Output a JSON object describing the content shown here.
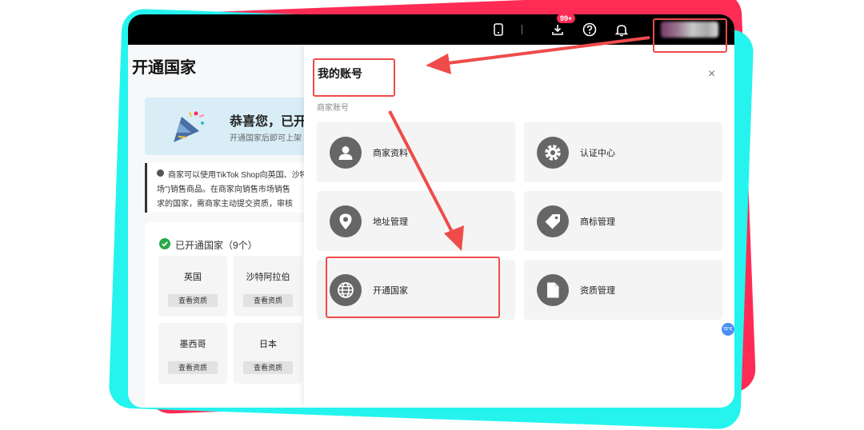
{
  "topbar": {
    "download_badge": "99+",
    "icons": [
      "phone-icon",
      "download-icon",
      "help-icon",
      "bell-icon"
    ]
  },
  "page": {
    "title": "开通国家",
    "banner": {
      "title": "恭喜您，已开通",
      "subtitle": "开通国家后即可上架"
    },
    "notice": {
      "lines": [
        "商家可以使用TikTok Shop向英国、沙特",
        "场\")销售商品。在商家向销售市场销售",
        "求的国家，需商家主动提交资质，审核"
      ]
    },
    "opened": {
      "title": "已开通国家（9个）",
      "countries": [
        {
          "name": "英国",
          "button": "查看资质"
        },
        {
          "name": "沙特阿拉伯",
          "button": "查看资质"
        },
        {
          "name": "墨西哥",
          "button": "查看资质"
        },
        {
          "name": "日本",
          "button": "查看资质"
        }
      ]
    }
  },
  "modal": {
    "title": "我的账号",
    "close": "×",
    "section": "商家账号",
    "tiles": [
      {
        "label": "商家资料",
        "icon": "user-icon"
      },
      {
        "label": "认证中心",
        "icon": "gear-icon"
      },
      {
        "label": "地址管理",
        "icon": "location-pin-icon"
      },
      {
        "label": "商标管理",
        "icon": "tag-icon"
      },
      {
        "label": "开通国家",
        "icon": "globe-icon"
      },
      {
        "label": "资质管理",
        "icon": "document-icon"
      }
    ]
  },
  "fab": {
    "label": "72℃"
  },
  "colors": {
    "accent_red": "#fe2c55",
    "accent_cyan": "#25f4ee",
    "annotation_red": "#ef4b4b",
    "icon_gray": "#666666"
  }
}
